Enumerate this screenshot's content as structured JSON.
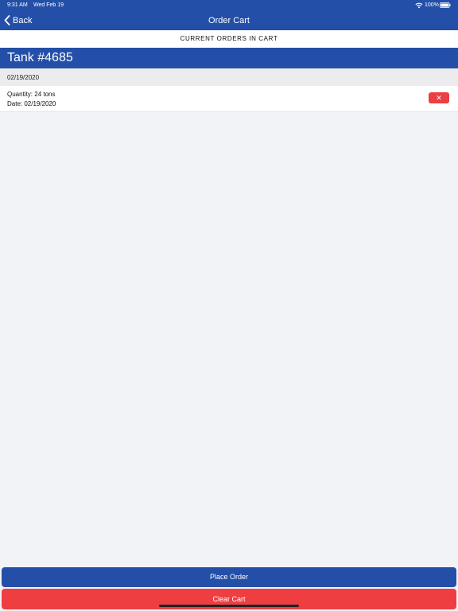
{
  "status_bar": {
    "time": "9:31 AM",
    "date": "Wed Feb 19",
    "battery": "100%",
    "icons": [
      "wifi-icon",
      "battery-icon"
    ]
  },
  "nav": {
    "back_label": "Back",
    "back_icon": "chevron-left-icon",
    "title": "Order Cart"
  },
  "section_header": "CURRENT ORDERS IN CART",
  "tank": {
    "title": "Tank #4685",
    "date": "02/19/2020",
    "orders": [
      {
        "quantity": "Quantity: 24 tons",
        "date": "Date: 02/19/2020",
        "remove_label": "✕"
      }
    ]
  },
  "actions": {
    "place_order": "Place Order",
    "clear_cart": "Clear Cart"
  },
  "colors": {
    "primary": "#234fa8",
    "danger": "#ef3e42",
    "background": "#f2f3f7"
  }
}
